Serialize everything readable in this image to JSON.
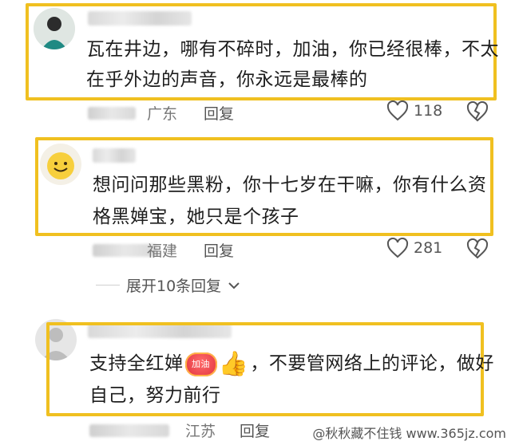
{
  "comments": [
    {
      "text_line1": "瓦在井边，哪有不碎时，加油，你已经很棒，不太",
      "text_line2": "在乎外边的声音，你永远是最棒的",
      "location": "广东",
      "reply_label": "回复",
      "likes": "118"
    },
    {
      "text_line1": "想问问那些黑粉，你十七岁在干嘛，你有什么资",
      "text_line2": "格黑婵宝，她只是个孩子",
      "location": "福建",
      "reply_label": "回复",
      "likes": "281"
    },
    {
      "text_line1_a": "支持全红婵",
      "emoji_badge": "加油",
      "emoji_thumb": "👍",
      "text_line1_b": "，不要管网络上的评论，做好",
      "text_line2": "自己，努力前行",
      "location": "江苏",
      "reply_label": "回复"
    }
  ],
  "expand_replies": "展开10条回复",
  "watermark": "@秋秋藏不住钱 www.365jz.com",
  "colors": {
    "highlight": "#f0c020",
    "meta": "#777777",
    "text": "#1e1e1e"
  }
}
